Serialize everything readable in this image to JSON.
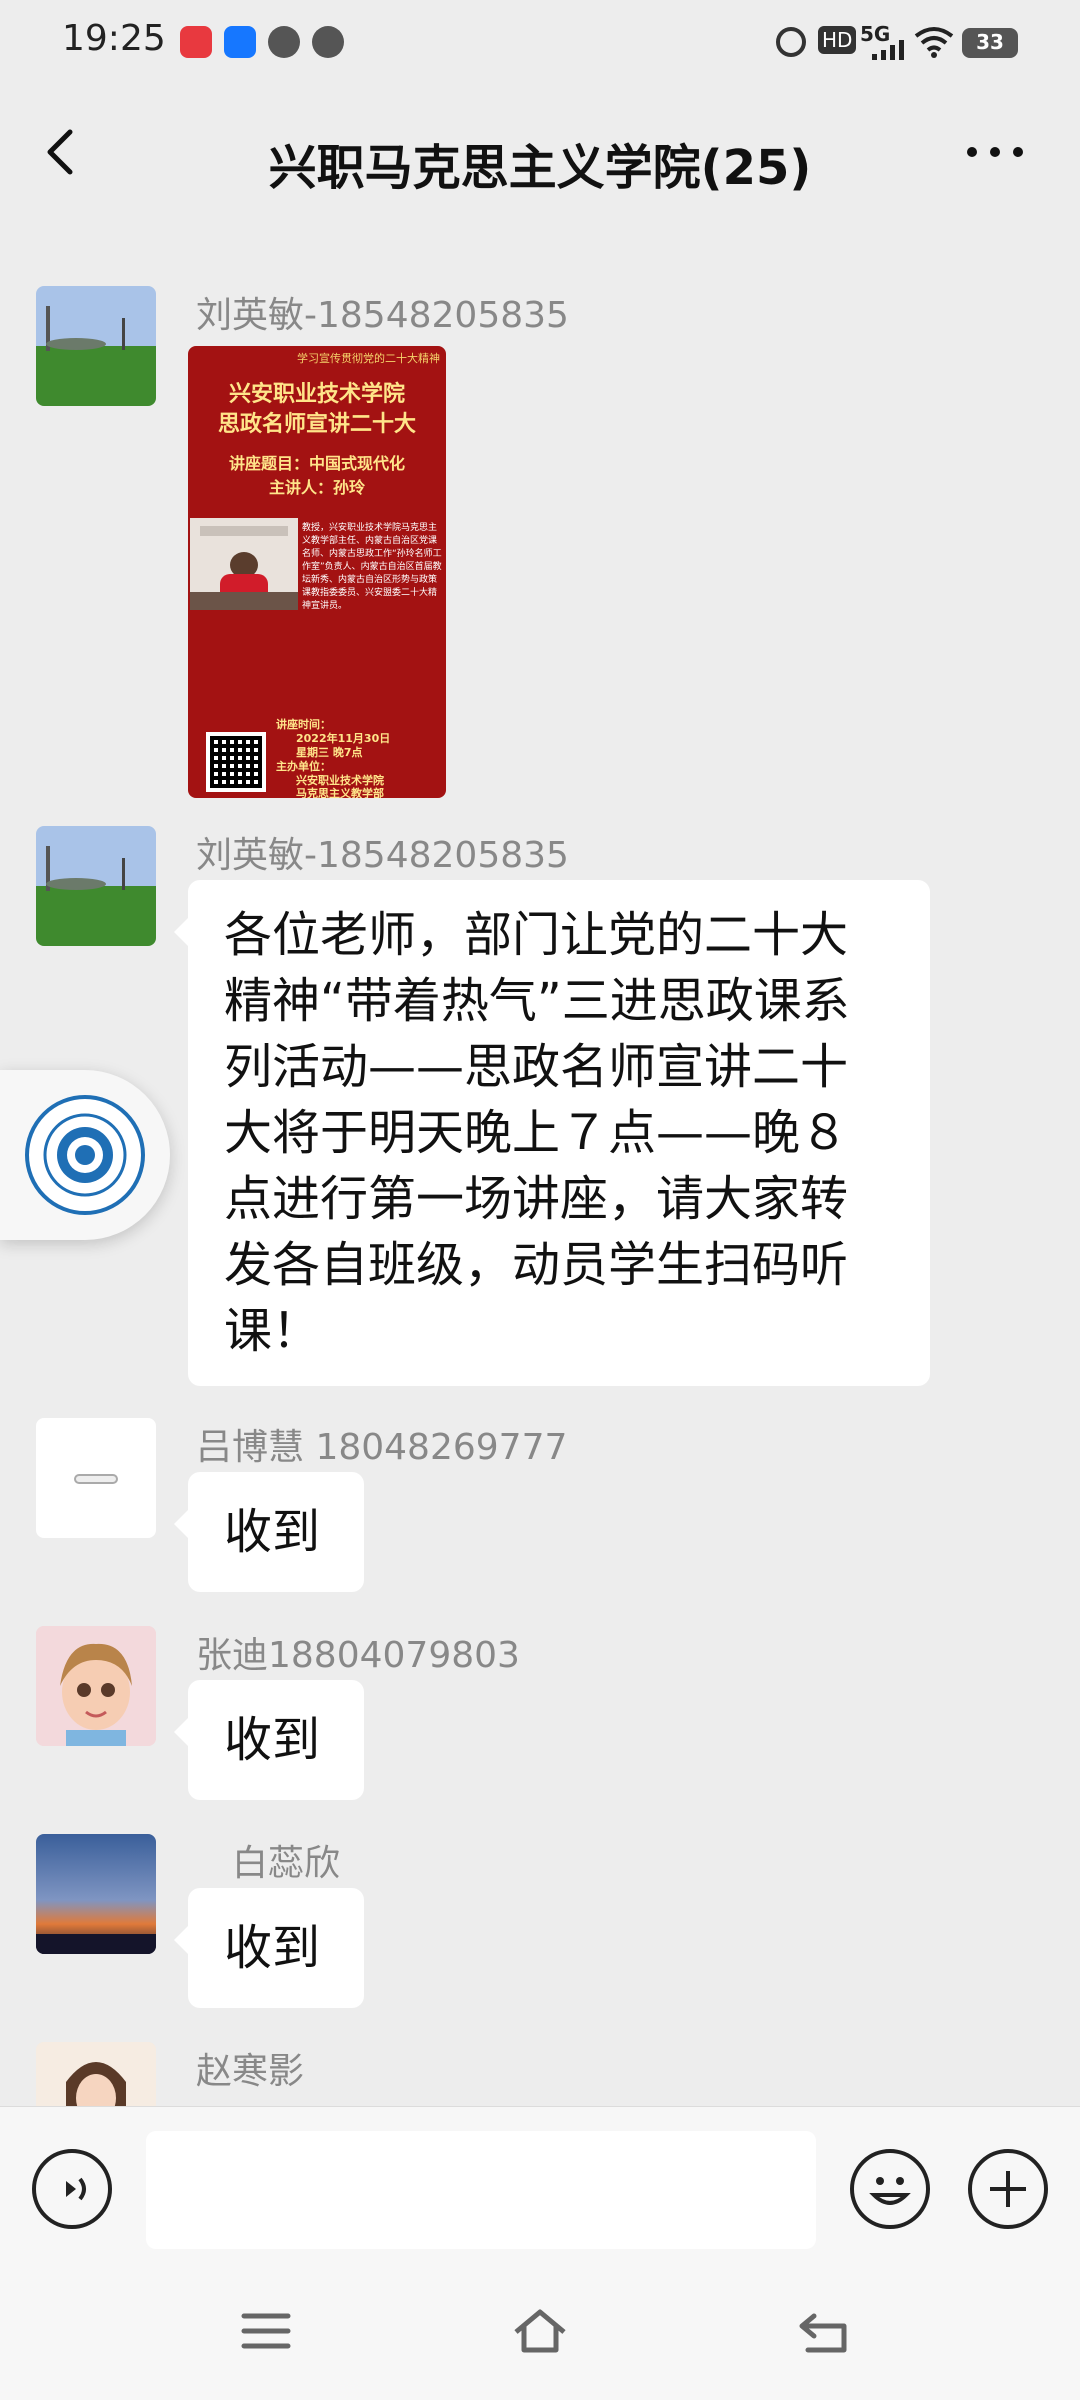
{
  "status": {
    "time": "19:25",
    "network": "5G",
    "hd": "HD",
    "battery": "33"
  },
  "header": {
    "title": "兴职马克思主义学院(25)"
  },
  "messages": [
    {
      "sender": "刘英敏-18548205835",
      "type": "image",
      "poster": {
        "top_text": "学习宣传贯彻党的二十大精神",
        "line1": "兴安职业技术学院",
        "line2": "思政名师宣讲二十大",
        "topic": "讲座题目：中国式现代化",
        "speaker": "主讲人：孙玲",
        "bio": "教授，兴安职业技术学院马克思主义教学部主任、内蒙古自治区党课名师、内蒙古思政工作“孙玲名师工作室”负责人、内蒙古自治区首届教坛新秀、内蒙古自治区形势与政策课教指委委员、兴安盟委二十大精神宣讲员。",
        "time_label": "讲座时间：",
        "date": "2022年11月30日",
        "weekday": "星期三 晚7点",
        "org_label": "主办单位：",
        "org1": "兴安职业技术学院",
        "org2": "马克思主义教学部"
      }
    },
    {
      "sender": "刘英敏-18548205835",
      "type": "text",
      "text": "各位老师，部门让党的二十大精神“带着热气”三进思政课系列活动——思政名师宣讲二十大将于明天晚上７点——晚８点进行第一场讲座，请大家转发各自班级，动员学生扫码听课！"
    },
    {
      "sender": "吕博慧  18048269777",
      "type": "text",
      "text": "收到"
    },
    {
      "sender": "张迪18804079803",
      "type": "text",
      "text": "收到"
    },
    {
      "sender": "白蕊欣",
      "type": "text",
      "text": "收到"
    },
    {
      "sender": "赵寒影",
      "type": "text",
      "text": ""
    }
  ],
  "colors": {
    "background": "#ededed",
    "bubble": "#ffffff",
    "poster_red": "#a31212",
    "sender_gray": "#888888"
  }
}
